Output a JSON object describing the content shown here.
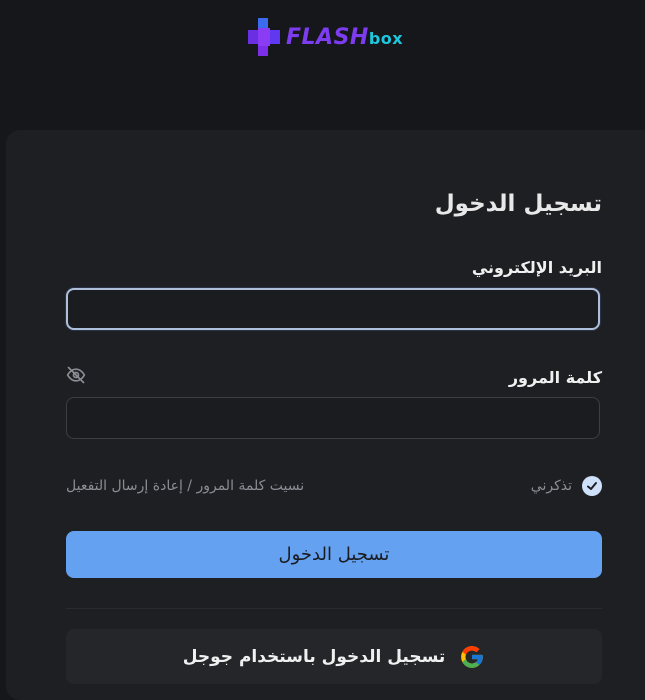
{
  "logo": {
    "part1": "FLASH",
    "part2": "box"
  },
  "login": {
    "title": "تسجيل الدخول",
    "email_label": "البريد الإلكتروني",
    "email_value": "",
    "password_label": "كلمة المرور",
    "password_value": "",
    "remember_label": "تذكرني",
    "remember_checked": true,
    "forgot_link": "نسيت كلمة المرور / إعادة إرسال التفعيل",
    "submit_label": "تسجيل الدخول",
    "google_label": "تسجيل الدخول باستخدام جوجل"
  },
  "colors": {
    "background": "#16171b",
    "card": "#1e1f23",
    "primary_button": "#64a1f0",
    "logo_purple": "#7d3cf0",
    "logo_cyan": "#1ec7df"
  },
  "icons": {
    "logo": "cross-logo-icon",
    "password_toggle": "eye-slash-icon",
    "remember": "check-circle-icon",
    "google": "google-g-icon"
  }
}
